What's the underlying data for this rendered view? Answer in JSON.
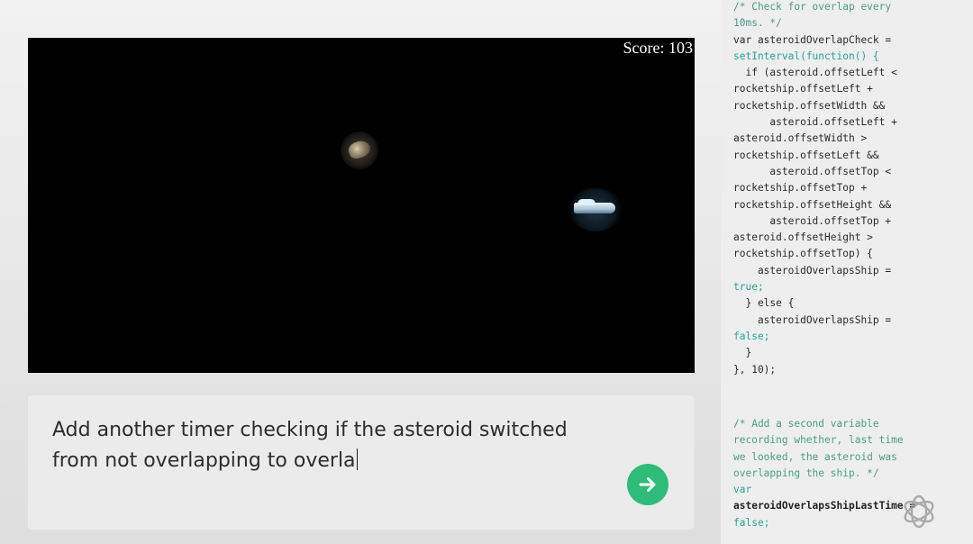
{
  "game": {
    "score_label": "Score: 103"
  },
  "prompt": {
    "line1": "Add another timer checking if the asteroid switched",
    "line2": "from not overlapping to overla"
  },
  "send_button": {
    "icon": "arrow-right-icon",
    "color": "#2fbb79"
  },
  "code": {
    "block1": [
      {
        "text": "/* Check for overlap every",
        "style": "comment"
      },
      {
        "text": "10ms. */",
        "style": "comment"
      },
      {
        "text": "var asteroidOverlapCheck =",
        "style": "plain"
      },
      {
        "text": "setInterval(function() {",
        "style": "teal"
      },
      {
        "text": "  if (asteroid.offsetLeft <",
        "style": "plain"
      },
      {
        "text": "rocketship.offsetLeft +",
        "style": "plain"
      },
      {
        "text": "rocketship.offsetWidth &&",
        "style": "plain"
      },
      {
        "text": "      asteroid.offsetLeft +",
        "style": "plain"
      },
      {
        "text": "asteroid.offsetWidth >",
        "style": "plain"
      },
      {
        "text": "rocketship.offsetLeft &&",
        "style": "plain"
      },
      {
        "text": "      asteroid.offsetTop <",
        "style": "plain"
      },
      {
        "text": "rocketship.offsetTop +",
        "style": "plain"
      },
      {
        "text": "rocketship.offsetHeight &&",
        "style": "plain"
      },
      {
        "text": "      asteroid.offsetTop +",
        "style": "plain"
      },
      {
        "text": "asteroid.offsetHeight >",
        "style": "plain"
      },
      {
        "text": "rocketship.offsetTop) {",
        "style": "plain"
      },
      {
        "text": "    asteroidOverlapsShip =",
        "style": "plain"
      },
      {
        "text": "true;",
        "style": "teal"
      },
      {
        "text": "  } else {",
        "style": "plain"
      },
      {
        "text": "    asteroidOverlapsShip =",
        "style": "plain"
      },
      {
        "text": "false;",
        "style": "teal"
      },
      {
        "text": "  }",
        "style": "plain"
      },
      {
        "text": "}, 10);",
        "style": "plain"
      }
    ],
    "block2": [
      {
        "text": "/* Add a second variable",
        "style": "comment"
      },
      {
        "text": "recording whether, last time",
        "style": "comment"
      },
      {
        "text": "we looked, the asteroid was",
        "style": "comment"
      },
      {
        "text": "overlapping the ship. */",
        "style": "comment"
      },
      {
        "text": "var",
        "style": "teal"
      },
      {
        "text": "asteroidOverlapsShipLastTime =",
        "style": "bold"
      },
      {
        "text": "false;",
        "style": "teal"
      }
    ]
  },
  "logo": {
    "icon": "openai-logo-icon"
  }
}
